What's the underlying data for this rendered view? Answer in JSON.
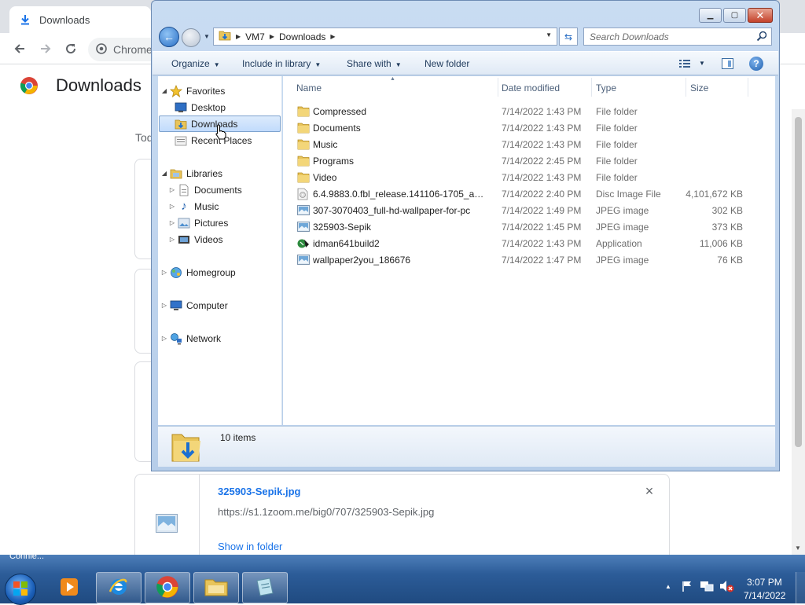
{
  "chrome": {
    "tab_title": "Downloads",
    "omnibox_chip": "Chrome",
    "page_title": "Downloads",
    "today_label": "Tod",
    "download_card": {
      "file_name": "325903-Sepik.jpg",
      "file_url": "https://s1.1zoom.me/big0/707/325903-Sepik.jpg",
      "show_in_folder": "Show in folder"
    },
    "colors": {
      "link": "#1a73e8",
      "accent": "#1a73e8"
    }
  },
  "explorer": {
    "address": {
      "segments": [
        "VM7",
        "Downloads"
      ]
    },
    "search": {
      "placeholder": "Search Downloads"
    },
    "toolbar": {
      "organize": "Organize",
      "include_in_library": "Include in library",
      "share_with": "Share with",
      "new_folder": "New folder"
    },
    "nav": {
      "favorites": "Favorites",
      "desktop": "Desktop",
      "downloads": "Downloads",
      "recent_places": "Recent Places",
      "libraries": "Libraries",
      "documents": "Documents",
      "music": "Music",
      "pictures": "Pictures",
      "videos": "Videos",
      "homegroup": "Homegroup",
      "computer": "Computer",
      "network": "Network"
    },
    "columns": {
      "name": "Name",
      "date": "Date modified",
      "type": "Type",
      "size": "Size"
    },
    "files": [
      {
        "name": "Compressed",
        "date": "7/14/2022 1:43 PM",
        "type": "File folder",
        "size": "",
        "icon": "folder-icon"
      },
      {
        "name": "Documents",
        "date": "7/14/2022 1:43 PM",
        "type": "File folder",
        "size": "",
        "icon": "folder-icon"
      },
      {
        "name": "Music",
        "date": "7/14/2022 1:43 PM",
        "type": "File folder",
        "size": "",
        "icon": "folder-icon"
      },
      {
        "name": "Programs",
        "date": "7/14/2022 2:45 PM",
        "type": "File folder",
        "size": "",
        "icon": "folder-icon"
      },
      {
        "name": "Video",
        "date": "7/14/2022 1:43 PM",
        "type": "File folder",
        "size": "",
        "icon": "folder-icon"
      },
      {
        "name": "6.4.9883.0.fbl_release.141106-1705_amd6...",
        "date": "7/14/2022 2:40 PM",
        "type": "Disc Image File",
        "size": "4,101,672 KB",
        "icon": "disc-image-icon"
      },
      {
        "name": "307-3070403_full-hd-wallpaper-for-pc",
        "date": "7/14/2022 1:49 PM",
        "type": "JPEG image",
        "size": "302 KB",
        "icon": "image-file-icon"
      },
      {
        "name": "325903-Sepik",
        "date": "7/14/2022 1:45 PM",
        "type": "JPEG image",
        "size": "373 KB",
        "icon": "image-file-icon"
      },
      {
        "name": "idman641build2",
        "date": "7/14/2022 1:43 PM",
        "type": "Application",
        "size": "11,006 KB",
        "icon": "application-icon"
      },
      {
        "name": "wallpaper2you_186676",
        "date": "7/14/2022 1:47 PM",
        "type": "JPEG image",
        "size": "76 KB",
        "icon": "image-file-icon"
      }
    ],
    "details": {
      "item_count": "10 items"
    }
  },
  "taskbar": {
    "peek_label": "Connie...",
    "clock_time": "3:07 PM",
    "clock_date": "7/14/2022",
    "apps": [
      "media-player-icon",
      "internet-explorer-icon",
      "chrome-icon",
      "file-explorer-icon",
      "notepad-icon"
    ]
  }
}
